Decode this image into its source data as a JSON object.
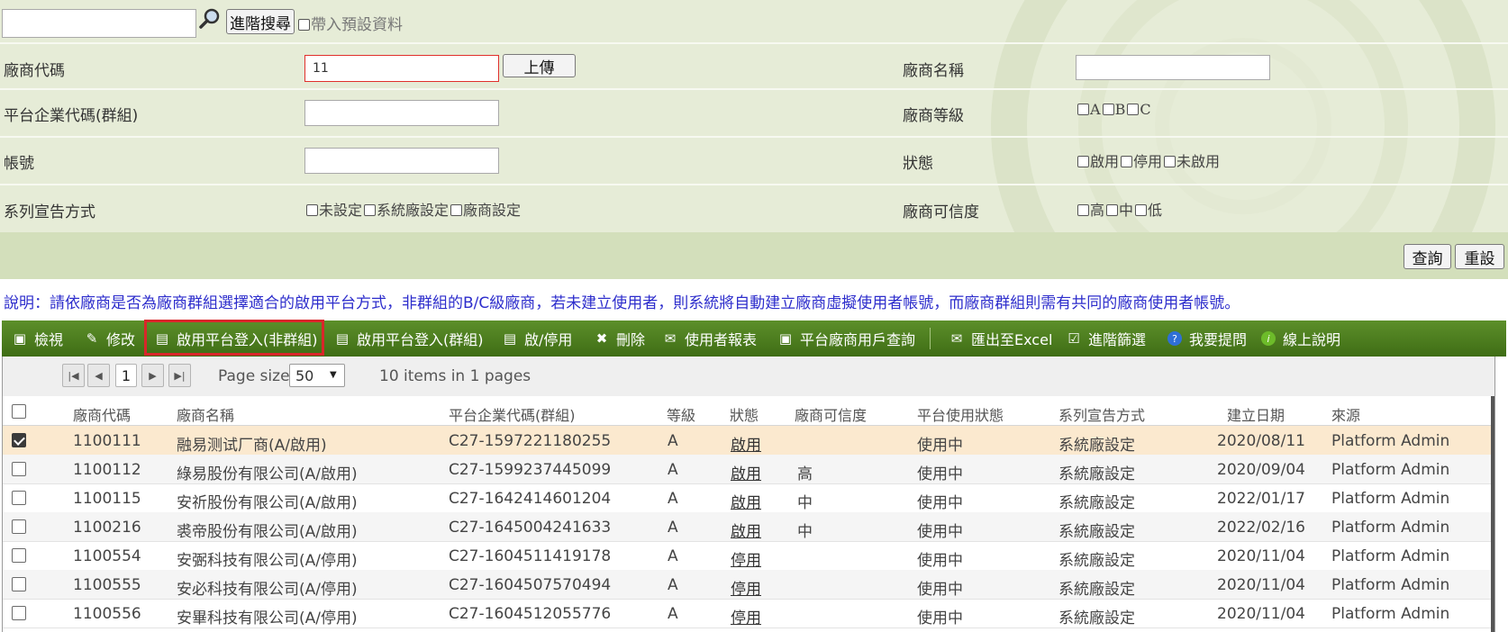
{
  "search_bar": {
    "advanced_search_label": "進階搜尋",
    "include_default_label": "帶入預設資料"
  },
  "form": {
    "vendor_code_label": "廠商代碼",
    "vendor_code_value": "11",
    "upload_label": "上傳",
    "vendor_name_label": "廠商名稱",
    "platform_code_label": "平台企業代碼(群組)",
    "vendor_level_label": "廠商等級",
    "level_options": [
      "A",
      "B",
      "C"
    ],
    "account_label": "帳號",
    "status_label": "狀態",
    "status_options": [
      "啟用",
      "停用",
      "未啟用"
    ],
    "series_label": "系列宣告方式",
    "series_options": [
      "未設定",
      "系統廠設定",
      "廠商設定"
    ],
    "credibility_label": "廠商可信度",
    "credibility_options": [
      "高",
      "中",
      "低"
    ],
    "query_label": "查詢",
    "reset_label": "重設"
  },
  "description": "說明：請依廠商是否為廠商群組選擇適合的啟用平台方式，非群組的B/C級廠商，若未建立使用者，則系統將自動建立廠商虛擬使用者帳號，而廠商群組則需有共同的廠商使用者帳號。",
  "toolbar": {
    "view": "檢視",
    "edit": "修改",
    "enable_login_nongroup": "啟用平台登入(非群組)",
    "enable_login_group": "啟用平台登入(群組)",
    "toggle": "啟/停用",
    "delete": "刪除",
    "user_report": "使用者報表",
    "vendor_user_query": "平台廠商用戶查詢",
    "export_excel": "匯出至Excel",
    "advanced_filter": "進階篩選",
    "ask_question": "我要提問",
    "online_help": "線上說明"
  },
  "pager": {
    "current_page": "1",
    "page_size_label": "Page size:",
    "page_size": "50",
    "items_text": "10 items in 1 pages"
  },
  "grid": {
    "headers": [
      "廠商代碼",
      "廠商名稱",
      "平台企業代碼(群組)",
      "等級",
      "狀態",
      "廠商可信度",
      "平台使用狀態",
      "系列宣告方式",
      "建立日期",
      "來源"
    ],
    "rows": [
      {
        "code": "1100111",
        "name": "融易测试厂商(A/啟用)",
        "platform": "C27-1597221180255",
        "level": "A",
        "status": "啟用",
        "cred": "",
        "usage": "使用中",
        "series": "系統廠設定",
        "date": "2020/08/11",
        "source": "Platform Admin"
      },
      {
        "code": "1100112",
        "name": "綠易股份有限公司(A/啟用)",
        "platform": "C27-1599237445099",
        "level": "A",
        "status": "啟用",
        "cred": "高",
        "usage": "使用中",
        "series": "系統廠設定",
        "date": "2020/09/04",
        "source": "Platform Admin"
      },
      {
        "code": "1100115",
        "name": "安祈股份有限公司(A/啟用)",
        "platform": "C27-1642414601204",
        "level": "A",
        "status": "啟用",
        "cred": "中",
        "usage": "使用中",
        "series": "系統廠設定",
        "date": "2022/01/17",
        "source": "Platform Admin"
      },
      {
        "code": "1100216",
        "name": "裘帝股份有限公司(A/啟用)",
        "platform": "C27-1645004241633",
        "level": "A",
        "status": "啟用",
        "cred": "中",
        "usage": "使用中",
        "series": "系統廠設定",
        "date": "2022/02/16",
        "source": "Platform Admin"
      },
      {
        "code": "1100554",
        "name": "安弻科技有限公司(A/停用)",
        "platform": "C27-1604511419178",
        "level": "A",
        "status": "停用",
        "cred": "",
        "usage": "使用中",
        "series": "系統廠設定",
        "date": "2020/11/04",
        "source": "Platform Admin"
      },
      {
        "code": "1100555",
        "name": "安必科技有限公司(A/停用)",
        "platform": "C27-1604507570494",
        "level": "A",
        "status": "停用",
        "cred": "",
        "usage": "使用中",
        "series": "系統廠設定",
        "date": "2020/11/04",
        "source": "Platform Admin"
      },
      {
        "code": "1100556",
        "name": "安畢科技有限公司(A/停用)",
        "platform": "C27-1604512055776",
        "level": "A",
        "status": "停用",
        "cred": "",
        "usage": "使用中",
        "series": "系統廠設定",
        "date": "2020/11/04",
        "source": "Platform Admin"
      }
    ]
  },
  "colors": {
    "toolbar_green": "#4a7a1e",
    "highlight_red": "#d9262a",
    "selected_row": "#fbe9cf",
    "description_blue": "#2d2dcc"
  }
}
